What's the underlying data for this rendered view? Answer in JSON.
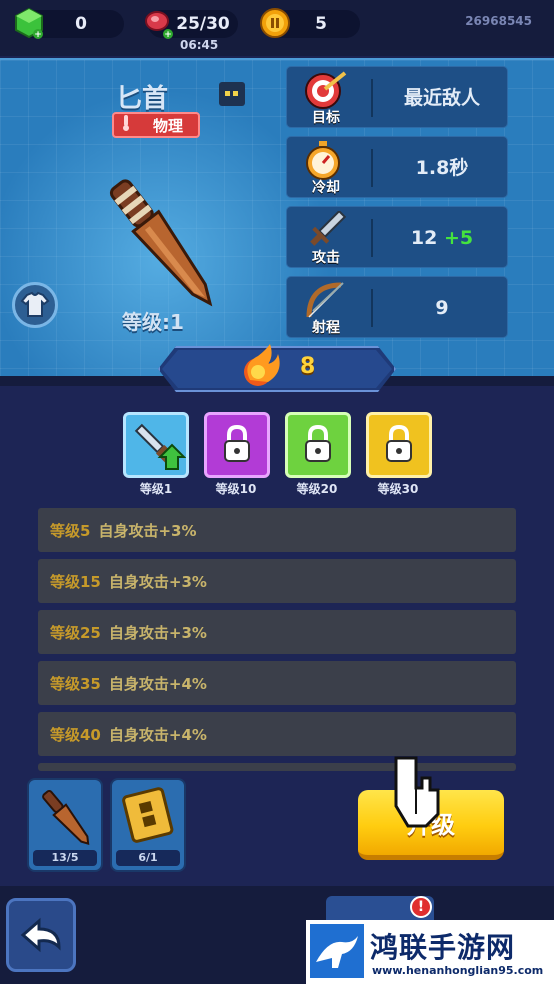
{
  "topbar": {
    "gems": "0",
    "energy": "25/30",
    "timer": "06:45",
    "coins": "5",
    "uid": "26968545"
  },
  "weapon": {
    "name": "匕首",
    "type": "物理",
    "level_label": "等级:1"
  },
  "stats": [
    {
      "label": "目标",
      "value": "最近敌人",
      "icon": "target-icon"
    },
    {
      "label": "冷却",
      "value": "1.8秒",
      "icon": "stopwatch-icon"
    },
    {
      "label": "攻击",
      "value": "12",
      "bonus": "+5",
      "icon": "sword-icon"
    },
    {
      "label": "射程",
      "value": "9",
      "icon": "bow-icon"
    }
  ],
  "fire_count": "8",
  "skills": [
    {
      "label": "等级1",
      "color": "#4fb6e8",
      "locked": false
    },
    {
      "label": "等级10",
      "color": "#b23bd6",
      "locked": true
    },
    {
      "label": "等级20",
      "color": "#6ed23f",
      "locked": true
    },
    {
      "label": "等级30",
      "color": "#f0c21f",
      "locked": true
    }
  ],
  "perks": [
    {
      "level": "等级5",
      "text": "自身攻击+3%"
    },
    {
      "level": "等级15",
      "text": "自身攻击+3%"
    },
    {
      "level": "等级25",
      "text": "自身攻击+3%"
    },
    {
      "level": "等级35",
      "text": "自身攻击+4%"
    },
    {
      "level": "等级40",
      "text": "自身攻击+4%"
    }
  ],
  "cards": [
    {
      "count": "13/5",
      "icon": "dagger-icon"
    },
    {
      "count": "6/1",
      "icon": "scroll-icon"
    }
  ],
  "upgrade_label": "升级",
  "nav_badge": "!",
  "watermark": {
    "title": "鸿联手游网",
    "url": "www.henanhonglian95.com"
  },
  "colors": {
    "panel_blue": "#2a7dbd",
    "upgrade_yellow": "#ffcd10",
    "bonus_green": "#45e43e",
    "tag_red": "#d63a3a"
  }
}
